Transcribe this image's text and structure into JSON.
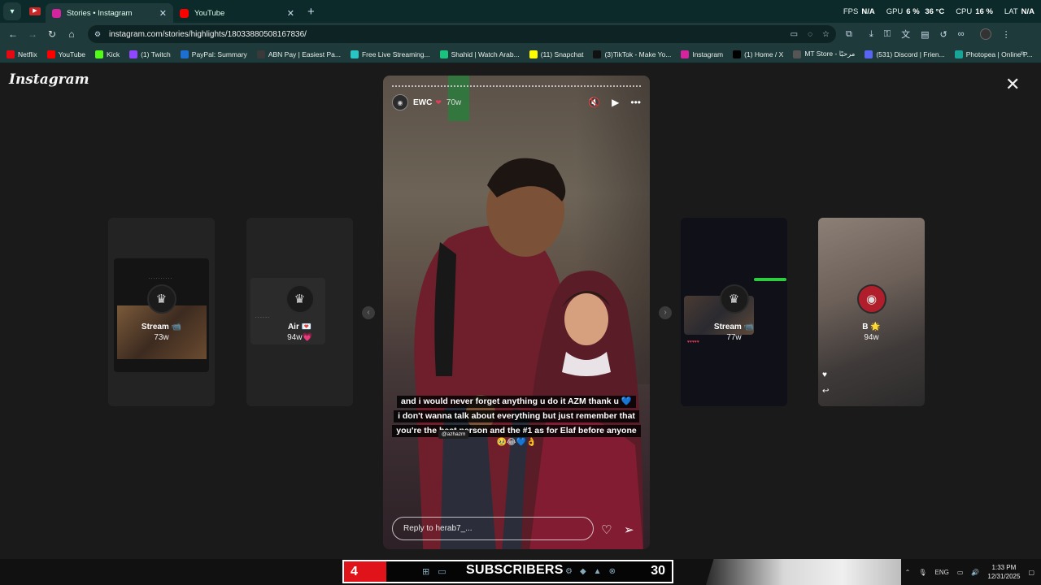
{
  "browser": {
    "tabs": [
      {
        "title": "Stories • Instagram",
        "active": true,
        "color": "#d6249f"
      },
      {
        "title": "YouTube",
        "active": false,
        "color": "#ff0000"
      }
    ],
    "perf": {
      "fps_label": "FPS",
      "fps_value": "N/A",
      "gpu_label": "GPU",
      "gpu_value": "6 %",
      "gpu_temp": "36 °C",
      "cpu_label": "CPU",
      "cpu_value": "16 %",
      "lat_label": "LAT",
      "lat_value": "N/A"
    },
    "url": "instagram.com/stories/highlights/18033880508167836/",
    "bookmarks": [
      {
        "label": "Netflix",
        "color": "#e50914"
      },
      {
        "label": "YouTube",
        "color": "#ff0000"
      },
      {
        "label": "Kick",
        "color": "#53fc18"
      },
      {
        "label": "(1) Twitch",
        "color": "#9146ff"
      },
      {
        "label": "PayPal: Summary",
        "color": "#1d6fd1"
      },
      {
        "label": "ABN Pay | Easiest Pa...",
        "color": "#3a3a3a"
      },
      {
        "label": "Free Live Streaming...",
        "color": "#29c5c5"
      },
      {
        "label": "Shahid | Watch Arab...",
        "color": "#19c37d"
      },
      {
        "label": "(11) Snapchat",
        "color": "#fffc00"
      },
      {
        "label": "(3)TikTok - Make Yo...",
        "color": "#111111"
      },
      {
        "label": "Instagram",
        "color": "#d6249f"
      },
      {
        "label": "(1) Home / X",
        "color": "#000000"
      },
      {
        "label": "MT Store - مرحبًا",
        "color": "#555555"
      },
      {
        "label": "(531) Discord | Frien...",
        "color": "#5865f2"
      },
      {
        "label": "Photopea | Online P...",
        "color": "#18a497"
      }
    ]
  },
  "instagram": {
    "logo": "Instagram",
    "side_stories": [
      {
        "name": "Stream 📹",
        "age": "73w"
      },
      {
        "name": "Air 💌",
        "age": "94w💗"
      },
      {
        "name": "Stream 📹",
        "age": "77w"
      },
      {
        "name": "B 🌟",
        "age": "94w"
      }
    ],
    "story": {
      "user": "EWC",
      "heart": "❤",
      "time": "70w",
      "caption_lines": [
        "and i would never forget anything u do it AZM thank u 💙",
        "i don't wanna talk about everything but just remember that",
        "you're the best person and the #1  as for Elaf before anyone"
      ],
      "caption_emoji": "🥹😂💙👌",
      "mention": "@azhazm",
      "reply_placeholder": "Reply to herab7_..."
    }
  },
  "taskbar": {
    "subscriber_count": "4",
    "subscriber_label": "SUBSCRIBERS",
    "subscriber_target": "30",
    "lang": "ENG",
    "time": "1:33 PM",
    "date": "12/31/2025"
  }
}
